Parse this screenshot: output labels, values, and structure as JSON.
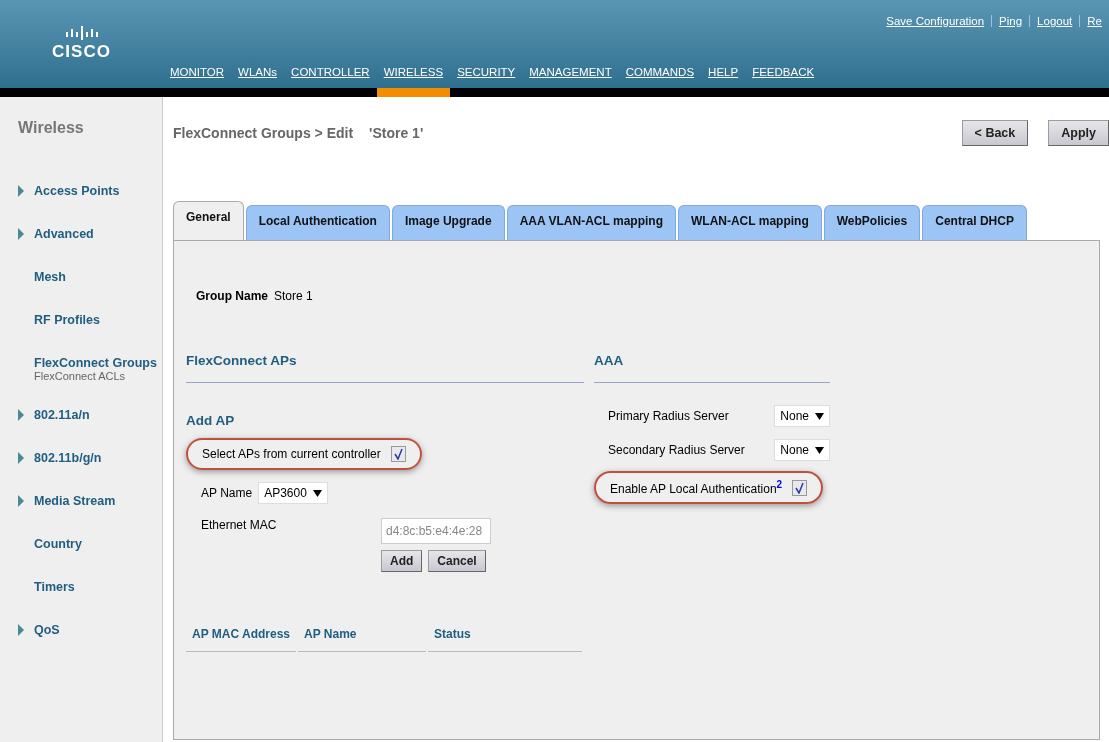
{
  "header": {
    "logo": "CISCO",
    "top_links": [
      "Save Configuration",
      "Ping",
      "Logout",
      "Re"
    ],
    "menu": [
      {
        "label": "MONITOR",
        "selected": false
      },
      {
        "label": "WLANs",
        "selected": false
      },
      {
        "label": "CONTROLLER",
        "selected": false
      },
      {
        "label": "WIRELESS",
        "selected": true
      },
      {
        "label": "SECURITY",
        "selected": false
      },
      {
        "label": "MANAGEMENT",
        "selected": false
      },
      {
        "label": "COMMANDS",
        "selected": false
      },
      {
        "label": "HELP",
        "selected": false
      },
      {
        "label": "FEEDBACK",
        "selected": false
      }
    ]
  },
  "sidebar": {
    "title": "Wireless",
    "items": [
      {
        "label": "Access Points",
        "expandable": true
      },
      {
        "label": "Advanced",
        "expandable": true
      },
      {
        "label": "Mesh",
        "expandable": false
      },
      {
        "label": "RF Profiles",
        "expandable": false
      },
      {
        "label": "FlexConnect Groups",
        "expandable": false,
        "children": [
          {
            "label": "FlexConnect ACLs"
          }
        ]
      },
      {
        "label": "802.11a/n",
        "expandable": true
      },
      {
        "label": "802.11b/g/n",
        "expandable": true
      },
      {
        "label": "Media Stream",
        "expandable": true
      },
      {
        "label": "Country",
        "expandable": false
      },
      {
        "label": "Timers",
        "expandable": false
      },
      {
        "label": "QoS",
        "expandable": true
      }
    ]
  },
  "page": {
    "title": "FlexConnect Groups > Edit",
    "subject": "'Store 1'",
    "buttons": [
      "< Back",
      "Apply"
    ]
  },
  "tabs": [
    {
      "label": "General",
      "selected": true
    },
    {
      "label": "Local Authentication",
      "selected": false
    },
    {
      "label": "Image Upgrade",
      "selected": false
    },
    {
      "label": "AAA VLAN-ACL mapping",
      "selected": false
    },
    {
      "label": "WLAN-ACL mapping",
      "selected": false
    },
    {
      "label": "WebPolicies",
      "selected": false
    },
    {
      "label": "Central DHCP",
      "selected": false
    }
  ],
  "group_name": {
    "label": "Group Name",
    "value": "Store 1"
  },
  "flexconnect_aps": {
    "heading": "FlexConnect APs",
    "add_ap": {
      "heading": "Add AP",
      "select_from_controller": {
        "label": "Select APs from current controller",
        "checked": true,
        "highlighted": true
      },
      "ap_name": {
        "label": "AP Name",
        "value": "AP3600"
      },
      "ethernet_mac": {
        "label": "Ethernet MAC",
        "placeholder": "d4:8c:b5:e4:4e:28"
      },
      "buttons": [
        "Add",
        "Cancel"
      ]
    },
    "table": {
      "columns": [
        "AP MAC Address",
        "AP Name",
        "Status"
      ]
    }
  },
  "aaa": {
    "heading": "AAA",
    "primary": {
      "label": "Primary Radius Server",
      "value": "None"
    },
    "secondary": {
      "label": "Secondary Radius Server",
      "value": "None"
    },
    "local_auth": {
      "label": "Enable AP Local Authentication",
      "footnote": "2",
      "checked": true,
      "highlighted": true
    }
  }
}
